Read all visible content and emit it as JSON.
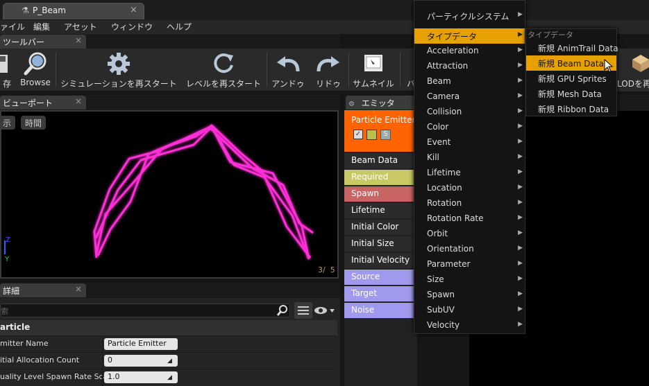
{
  "document_tab": {
    "title": "P_Beam",
    "close": "×"
  },
  "menubar": [
    "ァイル",
    "編集",
    "アセット",
    "ウィンドウ",
    "ヘルプ"
  ],
  "toolbar_tab": {
    "label": "ツールバー",
    "close": "×"
  },
  "toolbar": {
    "buttons": [
      {
        "label": "存",
        "icon": "save-icon"
      },
      {
        "label": "Browse",
        "icon": "browse-icon"
      },
      {
        "label": "シミュレーションを再スタート",
        "icon": "gear-icon"
      },
      {
        "label": "レベルを再スタート",
        "icon": "restart-icon"
      },
      {
        "label": "アンドゥ",
        "icon": "undo-icon"
      },
      {
        "label": "リドゥ",
        "icon": "redo-icon"
      },
      {
        "label": "サムネイル",
        "icon": "thumbnail-icon"
      },
      {
        "label": "バ",
        "icon": "bounds-icon"
      }
    ],
    "lod_label": "LODを再"
  },
  "viewport_tab": {
    "label": "ビューポート",
    "close": "×"
  },
  "viewport": {
    "show_btn": "示",
    "time_btn": "時間",
    "counter": "3/  5",
    "axis_z": "Z",
    "axis_y": "Y"
  },
  "details_tab": {
    "label": "詳細",
    "close": "×"
  },
  "details": {
    "search_placeholder": "索",
    "section": "article",
    "properties": [
      {
        "label": "mitter Name",
        "value": "Particle Emitter"
      },
      {
        "label": "itial Allocation Count",
        "value": "0"
      },
      {
        "label": "uality Level Spawn Rate Scale",
        "value": "1.0"
      }
    ]
  },
  "emitter_tab": {
    "label": "エミッタ"
  },
  "emitter": {
    "name": "Particle Emitter",
    "head_color": "#ff6400",
    "modules": [
      {
        "label": "Beam Data",
        "color": "#2b2b2b"
      },
      {
        "label": "Required",
        "color": "#c8c864"
      },
      {
        "label": "Spawn",
        "color": "#c86464"
      },
      {
        "label": "Lifetime",
        "color": "#2b2b2b"
      },
      {
        "label": "Initial Color",
        "color": "#2b2b2b"
      },
      {
        "label": "Initial Size",
        "color": "#2b2b2b"
      },
      {
        "label": "Initial Velocity",
        "color": "#2b2b2b"
      },
      {
        "label": "Source",
        "color": "#a09aee"
      },
      {
        "label": "Target",
        "color": "#a09aee"
      },
      {
        "label": "Noise",
        "color": "#a09aee"
      }
    ]
  },
  "context_menu": {
    "items": [
      {
        "label": "パーティクルシステム",
        "selected": false
      },
      {
        "label": "タイプデータ",
        "selected": true
      },
      {
        "label": "Acceleration",
        "selected": false
      },
      {
        "label": "Attraction",
        "selected": false
      },
      {
        "label": "Beam",
        "selected": false
      },
      {
        "label": "Camera",
        "selected": false
      },
      {
        "label": "Collision",
        "selected": false
      },
      {
        "label": "Color",
        "selected": false
      },
      {
        "label": "Event",
        "selected": false
      },
      {
        "label": "Kill",
        "selected": false
      },
      {
        "label": "Lifetime",
        "selected": false
      },
      {
        "label": "Location",
        "selected": false
      },
      {
        "label": "Rotation",
        "selected": false
      },
      {
        "label": "Rotation Rate",
        "selected": false
      },
      {
        "label": "Orbit",
        "selected": false
      },
      {
        "label": "Orientation",
        "selected": false
      },
      {
        "label": "Parameter",
        "selected": false
      },
      {
        "label": "Size",
        "selected": false
      },
      {
        "label": "Spawn",
        "selected": false
      },
      {
        "label": "SubUV",
        "selected": false
      },
      {
        "label": "Velocity",
        "selected": false
      }
    ],
    "accent": "#e6a100"
  },
  "submenu": {
    "header": "タイプデータ",
    "items": [
      {
        "label": "新規 AnimTrail Data",
        "selected": false
      },
      {
        "label": "新規 Beam Data",
        "selected": true
      },
      {
        "label": "新規 GPU Sprites",
        "selected": false
      },
      {
        "label": "新規 Mesh Data",
        "selected": false
      },
      {
        "label": "新規 Ribbon Data",
        "selected": false
      }
    ]
  },
  "beam_color": "#ff2fd6"
}
